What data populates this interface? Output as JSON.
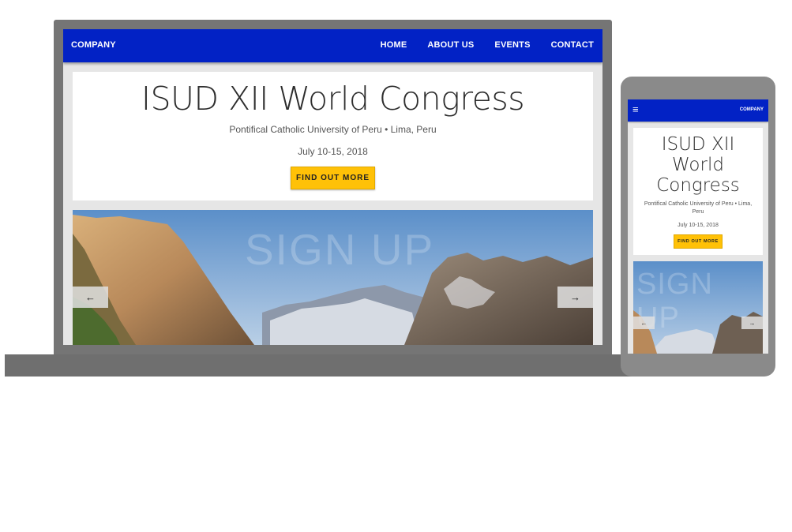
{
  "site": {
    "brand": "COMPANY",
    "nav": [
      "HOME",
      "ABOUT US",
      "EVENTS",
      "CONTACT"
    ]
  },
  "hero": {
    "title": "ISUD XII World Congress",
    "subtitle": "Pontifical Catholic University of Peru • Lima, Peru",
    "date": "July 10-15, 2018",
    "cta": "FIND OUT MORE"
  },
  "carousel": {
    "slide_label": "SIGN UP",
    "prev_icon": "←",
    "next_icon": "→"
  },
  "mobile": {
    "menu_icon": "≡",
    "brand": "COMPANY",
    "slide_label": "SIGN UP"
  },
  "colors": {
    "navbar": "#0222c5",
    "cta": "#ffc107",
    "device_frame": "#757575"
  }
}
